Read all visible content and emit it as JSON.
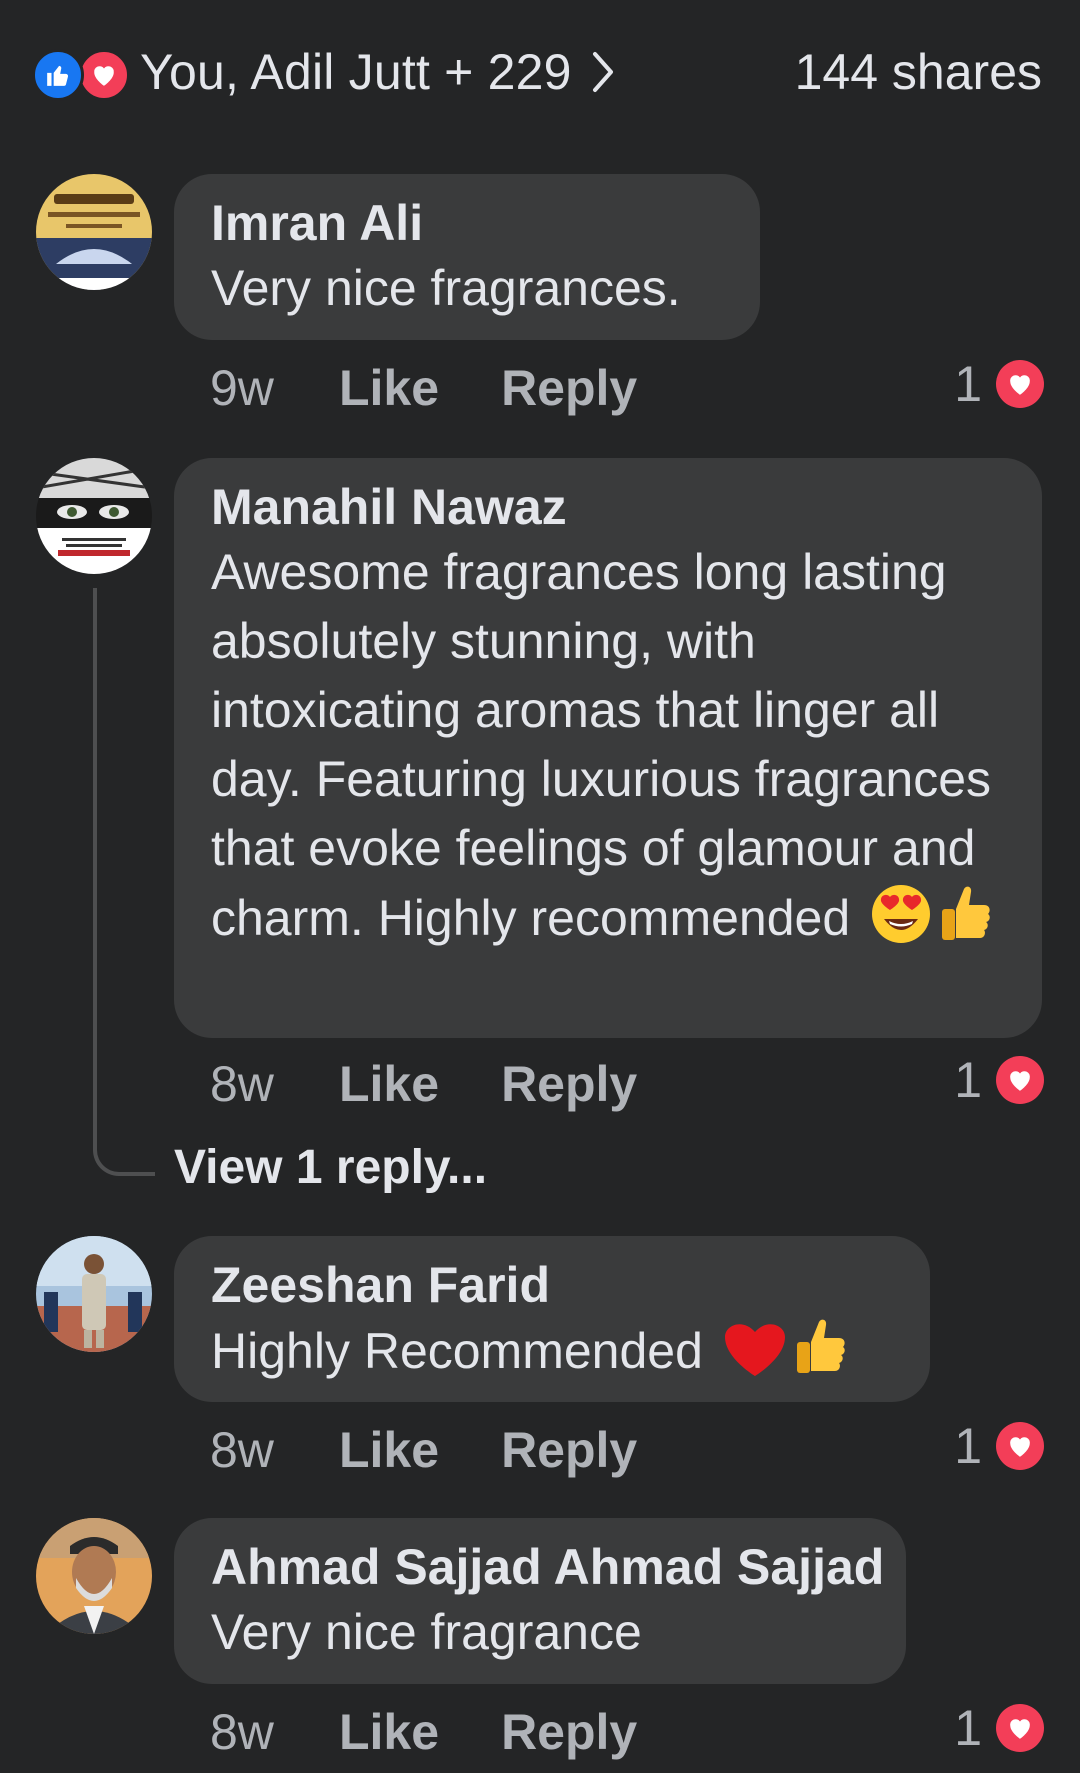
{
  "reactions": {
    "summary": "You, Adil Jutt + 229",
    "shares": "144 shares",
    "icons": [
      "like-icon",
      "love-icon",
      "chevron-right-icon"
    ]
  },
  "comments": [
    {
      "author": "Imran Ali",
      "text": "Very nice fragrances.",
      "time": "9w",
      "like_label": "Like",
      "reply_label": "Reply",
      "reaction_count": "1",
      "reaction_icon": "love-icon"
    },
    {
      "author": "Manahil Nawaz",
      "text": "Awesome fragrances long lasting absolutely stunning, with intoxicating aromas that linger all day. Featuring luxurious fragrances that evoke feelings of glamour and charm. Highly recommended",
      "emojis": [
        "heart-eyes-emoji",
        "thumbs-up-emoji"
      ],
      "time": "8w",
      "like_label": "Like",
      "reply_label": "Reply",
      "reaction_count": "1",
      "reaction_icon": "love-icon",
      "view_replies": "View 1 reply..."
    },
    {
      "author": "Zeeshan Farid",
      "text": "Highly Recommended",
      "emojis": [
        "red-heart-emoji",
        "thumbs-up-emoji"
      ],
      "time": "8w",
      "like_label": "Like",
      "reply_label": "Reply",
      "reaction_count": "1",
      "reaction_icon": "love-icon"
    },
    {
      "author": "Ahmad Sajjad Ahmad Sajjad",
      "text": "Very nice fragrance",
      "time": "8w",
      "like_label": "Like",
      "reply_label": "Reply",
      "reaction_count": "1",
      "reaction_icon": "love-icon"
    }
  ],
  "colors": {
    "background": "#242526",
    "bubble": "#3a3b3c",
    "primary_text": "#e4e6eb",
    "secondary_text": "#b0b3b8",
    "like_blue": "#1877f2",
    "love_red": "#f33e58"
  }
}
